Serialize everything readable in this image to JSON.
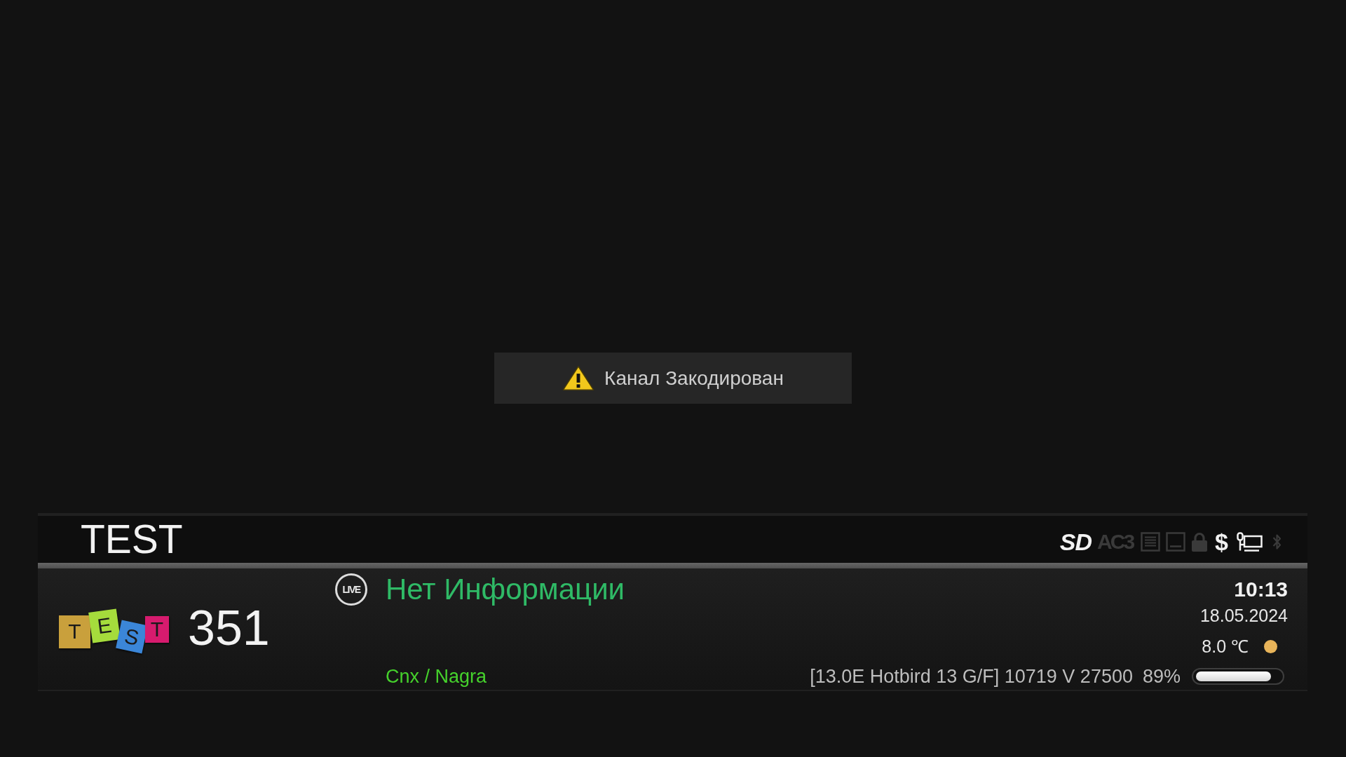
{
  "popup": {
    "message": "Канал Закодирован"
  },
  "infobar": {
    "channel_name": "TEST",
    "status_icons": [
      {
        "kind": "video_format",
        "label": "SD",
        "active": true
      },
      {
        "kind": "audio_format",
        "label": "AC3",
        "active": false
      },
      {
        "kind": "teletext",
        "active": false
      },
      {
        "kind": "subtitles",
        "active": false
      },
      {
        "kind": "lock",
        "active": false
      },
      {
        "kind": "scrambled",
        "label": "$",
        "active": true
      },
      {
        "kind": "network",
        "active": true
      },
      {
        "kind": "bluetooth",
        "active": false
      }
    ],
    "logo": {
      "tiles": [
        {
          "letter": "T",
          "color": "#c9a03c"
        },
        {
          "letter": "E",
          "color": "#a5dc3c"
        },
        {
          "letter": "S",
          "color": "#3b86d8"
        },
        {
          "letter": "T",
          "color": "#d61b6e"
        }
      ]
    },
    "channel_number": "351",
    "live_badge": "LIVE",
    "event_title": "Нет Информации",
    "encryption": "Cnx / Nagra",
    "time": "10:13",
    "date": "18.05.2024",
    "temperature": "8.0 ℃",
    "transponder": "[13.0E Hotbird 13 G/F] 10719 V 27500",
    "signal": {
      "reading": "89%",
      "level": 0.89
    }
  }
}
